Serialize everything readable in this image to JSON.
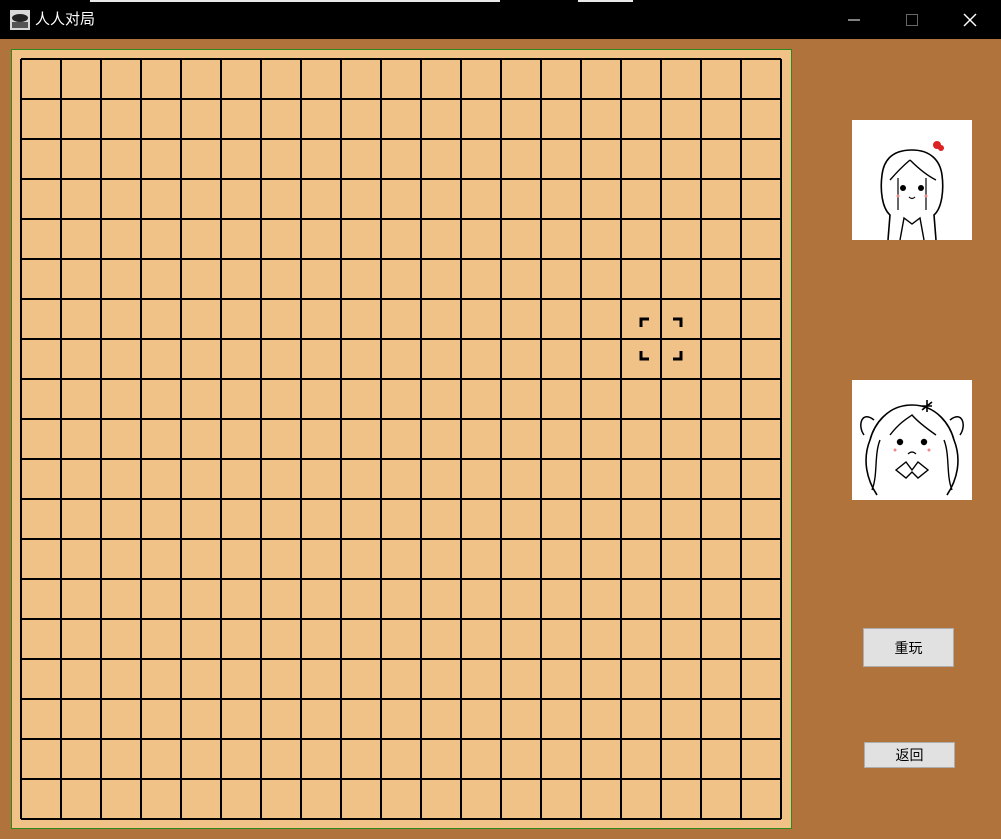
{
  "window": {
    "title": "人人对局",
    "controls": [
      "minimize-icon",
      "maximize-icon",
      "close-icon"
    ]
  },
  "board": {
    "columns": 19,
    "rows": 19,
    "cursor": {
      "col": 16,
      "row": 7
    },
    "colors": {
      "wood": "#f0c288",
      "line": "#000000",
      "frame": "#2f8a1e"
    }
  },
  "players": [
    {
      "avatar": "girl-avatar-1"
    },
    {
      "avatar": "girl-avatar-2"
    }
  ],
  "buttons": {
    "replay": "重玩",
    "back": "返回"
  },
  "colors": {
    "background": "#b0733c",
    "titlebar": "#000000"
  }
}
